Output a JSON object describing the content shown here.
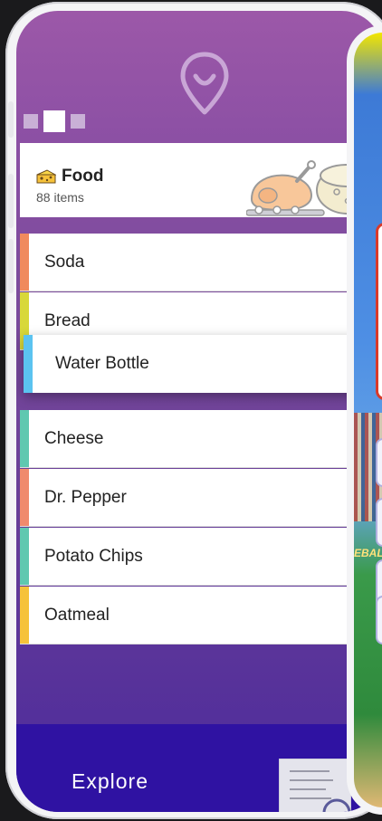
{
  "category": {
    "title": "Food",
    "subtitle": "88 items",
    "icon": "cheese-icon"
  },
  "list": [
    {
      "label": "Soda",
      "color": "#f08a5d"
    },
    {
      "label": "Bread",
      "color": "#d8d83a"
    },
    {
      "label": "Water Bottle",
      "color": "#5bc3f0"
    },
    {
      "label": "Cheese",
      "color": "#5fc8b0"
    },
    {
      "label": "Dr. Pepper",
      "color": "#f08a6d"
    },
    {
      "label": "Potato Chips",
      "color": "#5fc8b0"
    },
    {
      "label": "Oatmeal",
      "color": "#f6c23a"
    }
  ],
  "bottom": {
    "explore_label": "Explore"
  },
  "right_screen": {
    "partial_text": "EBAL"
  },
  "colors": {
    "accent_bottom": "#2f12a2",
    "background_top": "#9c58a8"
  }
}
